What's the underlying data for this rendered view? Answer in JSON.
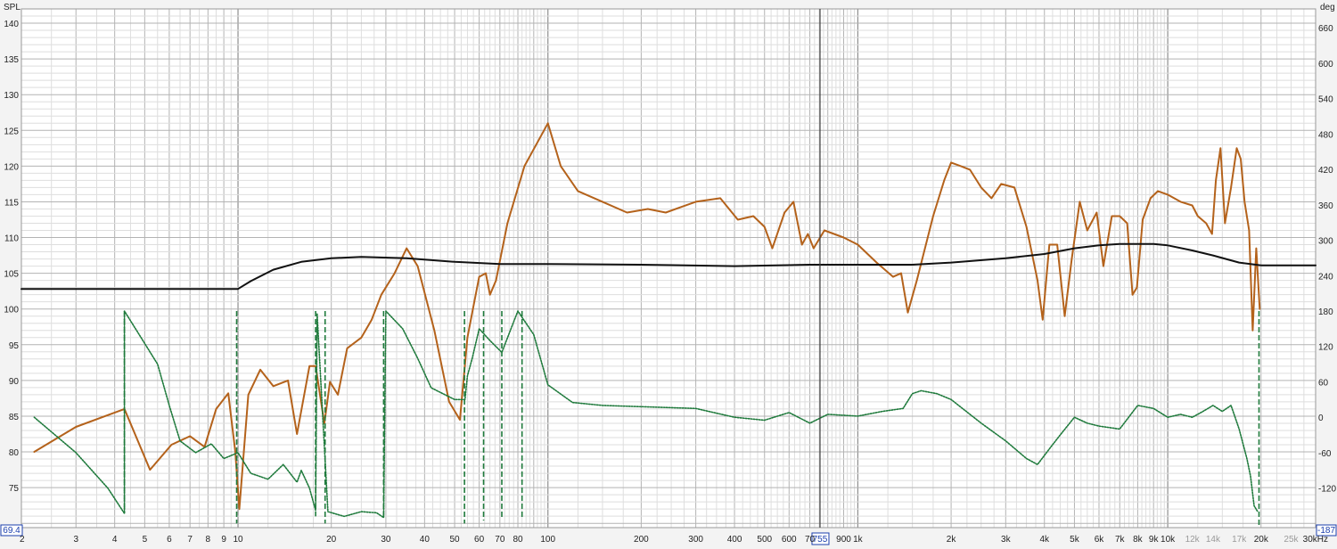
{
  "app": {
    "left_axis_title": "SPL",
    "right_axis_title": "deg"
  },
  "cursor": {
    "readout_freq": "755",
    "left_readout": "69.4",
    "right_readout": "-187"
  },
  "colors": {
    "spl_curve": "#b4621b",
    "phase_curve": "#1f7a3c",
    "black_curve": "#111111",
    "grid_major": "#b3b3b3",
    "grid_minor": "#dedede",
    "cursor_line": "#3a3a3a",
    "cursor_box": "#1b3fae"
  },
  "chart_data": {
    "type": "line",
    "x_scale": "log",
    "x_unit": "Hz",
    "xlim": [
      2,
      30000
    ],
    "ylim": [
      69.4,
      142
    ],
    "y_unit": "SPL",
    "y2lim": [
      -187,
      692
    ],
    "y2_unit": "deg",
    "grid": true,
    "x_ticks": [
      {
        "value": 2,
        "label": "2",
        "muted": false
      },
      {
        "value": 3,
        "label": "3",
        "muted": false
      },
      {
        "value": 4,
        "label": "4",
        "muted": false
      },
      {
        "value": 5,
        "label": "5",
        "muted": false
      },
      {
        "value": 6,
        "label": "6",
        "muted": false
      },
      {
        "value": 7,
        "label": "7",
        "muted": false
      },
      {
        "value": 8,
        "label": "8",
        "muted": false
      },
      {
        "value": 9,
        "label": "9",
        "muted": false
      },
      {
        "value": 10,
        "label": "10",
        "muted": false
      },
      {
        "value": 20,
        "label": "20",
        "muted": false
      },
      {
        "value": 30,
        "label": "30",
        "muted": false
      },
      {
        "value": 40,
        "label": "40",
        "muted": false
      },
      {
        "value": 50,
        "label": "50",
        "muted": false
      },
      {
        "value": 60,
        "label": "60",
        "muted": false
      },
      {
        "value": 70,
        "label": "70",
        "muted": false
      },
      {
        "value": 80,
        "label": "80",
        "muted": false
      },
      {
        "value": 100,
        "label": "100",
        "muted": false
      },
      {
        "value": 200,
        "label": "200",
        "muted": false
      },
      {
        "value": 300,
        "label": "300",
        "muted": false
      },
      {
        "value": 400,
        "label": "400",
        "muted": false
      },
      {
        "value": 500,
        "label": "500",
        "muted": false
      },
      {
        "value": 600,
        "label": "600",
        "muted": false
      },
      {
        "value": 700,
        "label": "70",
        "muted": false
      },
      {
        "value": 900,
        "label": "900",
        "muted": false
      },
      {
        "value": 1000,
        "label": "1k",
        "muted": false
      },
      {
        "value": 2000,
        "label": "2k",
        "muted": false
      },
      {
        "value": 3000,
        "label": "3k",
        "muted": false
      },
      {
        "value": 4000,
        "label": "4k",
        "muted": false
      },
      {
        "value": 5000,
        "label": "5k",
        "muted": false
      },
      {
        "value": 6000,
        "label": "6k",
        "muted": false
      },
      {
        "value": 7000,
        "label": "7k",
        "muted": false
      },
      {
        "value": 8000,
        "label": "8k",
        "muted": false
      },
      {
        "value": 9000,
        "label": "9k",
        "muted": false
      },
      {
        "value": 10000,
        "label": "10k",
        "muted": false
      },
      {
        "value": 12000,
        "label": "12k",
        "muted": true
      },
      {
        "value": 14000,
        "label": "14k",
        "muted": true
      },
      {
        "value": 17000,
        "label": "17k",
        "muted": true
      },
      {
        "value": 20000,
        "label": "20k",
        "muted": false
      },
      {
        "value": 25000,
        "label": "25k",
        "muted": true
      },
      {
        "value": 30000,
        "label": "30kHz",
        "muted": false
      }
    ],
    "y_ticks": [
      75,
      80,
      85,
      90,
      95,
      100,
      105,
      110,
      115,
      120,
      125,
      130,
      135,
      140
    ],
    "y2_ticks": [
      -120,
      -60,
      0,
      60,
      120,
      180,
      240,
      300,
      360,
      420,
      480,
      540,
      600,
      660
    ],
    "cursor_x": 755,
    "series": [
      {
        "key": "spl",
        "axis": "left",
        "style": "solid",
        "points": [
          [
            2.2,
            80
          ],
          [
            3,
            83.5
          ],
          [
            4.3,
            86
          ],
          [
            5.2,
            77.5
          ],
          [
            6.1,
            81
          ],
          [
            7,
            82.2
          ],
          [
            7.8,
            80.7
          ],
          [
            8.5,
            86
          ],
          [
            9.3,
            88.2
          ],
          [
            9.8,
            80
          ],
          [
            10.1,
            72
          ],
          [
            10.8,
            88
          ],
          [
            11.8,
            91.5
          ],
          [
            13,
            89.2
          ],
          [
            14.5,
            90
          ],
          [
            15.5,
            82.5
          ],
          [
            17,
            92
          ],
          [
            17.8,
            92
          ],
          [
            19,
            84
          ],
          [
            19.8,
            89.8
          ],
          [
            21,
            88
          ],
          [
            22.5,
            94.5
          ],
          [
            25,
            96
          ],
          [
            27,
            98.5
          ],
          [
            29,
            102
          ],
          [
            32,
            105
          ],
          [
            35,
            108.5
          ],
          [
            38,
            106
          ],
          [
            43,
            97
          ],
          [
            48,
            87
          ],
          [
            52,
            84.5
          ],
          [
            55,
            96
          ],
          [
            57,
            99.5
          ],
          [
            60,
            104.5
          ],
          [
            63,
            105
          ],
          [
            65,
            102
          ],
          [
            68,
            104
          ],
          [
            74,
            112
          ],
          [
            84,
            120
          ],
          [
            100,
            126
          ],
          [
            110,
            120
          ],
          [
            125,
            116.5
          ],
          [
            150,
            115
          ],
          [
            180,
            113.5
          ],
          [
            210,
            114
          ],
          [
            240,
            113.5
          ],
          [
            300,
            115
          ],
          [
            360,
            115.5
          ],
          [
            410,
            112.5
          ],
          [
            460,
            113
          ],
          [
            500,
            111.5
          ],
          [
            530,
            108.5
          ],
          [
            580,
            113.5
          ],
          [
            620,
            115
          ],
          [
            660,
            109
          ],
          [
            690,
            110.5
          ],
          [
            720,
            108.5
          ],
          [
            780,
            111
          ],
          [
            900,
            110
          ],
          [
            1000,
            109
          ],
          [
            1150,
            106.5
          ],
          [
            1300,
            104.5
          ],
          [
            1380,
            105
          ],
          [
            1450,
            99.5
          ],
          [
            1550,
            104
          ],
          [
            1750,
            113
          ],
          [
            1900,
            118
          ],
          [
            2000,
            120.5
          ],
          [
            2150,
            120
          ],
          [
            2300,
            119.5
          ],
          [
            2500,
            117
          ],
          [
            2700,
            115.5
          ],
          [
            2900,
            117.5
          ],
          [
            3200,
            117
          ],
          [
            3500,
            111.5
          ],
          [
            3800,
            104
          ],
          [
            3950,
            98.5
          ],
          [
            4150,
            109
          ],
          [
            4400,
            109
          ],
          [
            4650,
            99
          ],
          [
            4900,
            107
          ],
          [
            5200,
            115
          ],
          [
            5500,
            111
          ],
          [
            5900,
            113.5
          ],
          [
            6200,
            106
          ],
          [
            6600,
            113
          ],
          [
            7000,
            113
          ],
          [
            7400,
            112
          ],
          [
            7700,
            102
          ],
          [
            7950,
            103
          ],
          [
            8300,
            112.5
          ],
          [
            8800,
            115.5
          ],
          [
            9300,
            116.5
          ],
          [
            10000,
            116
          ],
          [
            11000,
            115
          ],
          [
            12000,
            114.5
          ],
          [
            12500,
            113
          ],
          [
            13300,
            112
          ],
          [
            13900,
            110.5
          ],
          [
            14300,
            118
          ],
          [
            14800,
            122.5
          ],
          [
            15300,
            112
          ],
          [
            16000,
            117
          ],
          [
            16700,
            122.5
          ],
          [
            17200,
            121
          ],
          [
            17700,
            115
          ],
          [
            18300,
            111
          ],
          [
            18800,
            97
          ],
          [
            19300,
            108.5
          ],
          [
            19800,
            100
          ]
        ]
      },
      {
        "key": "black",
        "axis": "left",
        "style": "solid",
        "points": [
          [
            2,
            102.8
          ],
          [
            10,
            102.8
          ],
          [
            11,
            103.9
          ],
          [
            13,
            105.5
          ],
          [
            16,
            106.6
          ],
          [
            20,
            107.1
          ],
          [
            25,
            107.3
          ],
          [
            35,
            107.1
          ],
          [
            50,
            106.6
          ],
          [
            70,
            106.3
          ],
          [
            100,
            106.3
          ],
          [
            200,
            106.2
          ],
          [
            400,
            106
          ],
          [
            700,
            106.2
          ],
          [
            1000,
            106.2
          ],
          [
            1500,
            106.2
          ],
          [
            2000,
            106.5
          ],
          [
            3000,
            107.1
          ],
          [
            4000,
            107.7
          ],
          [
            5000,
            108.5
          ],
          [
            6000,
            108.9
          ],
          [
            7000,
            109.1
          ],
          [
            9000,
            109.1
          ],
          [
            10000,
            108.9
          ],
          [
            12000,
            108.2
          ],
          [
            14000,
            107.5
          ],
          [
            17000,
            106.5
          ],
          [
            20000,
            106.1
          ],
          [
            30000,
            106.1
          ]
        ]
      },
      {
        "key": "phase",
        "axis": "right",
        "style": "dotted",
        "points": [
          [
            2.2,
            0
          ],
          [
            3,
            -60
          ],
          [
            3.8,
            -120
          ],
          [
            4.3,
            -163
          ],
          [
            4.3,
            180
          ],
          [
            4.8,
            140
          ],
          [
            5.5,
            90
          ],
          [
            6,
            20
          ],
          [
            6.5,
            -40
          ],
          [
            7.3,
            -60
          ],
          [
            8.2,
            -45
          ],
          [
            9,
            -70
          ],
          [
            10,
            -60
          ],
          [
            11,
            -95
          ],
          [
            12.5,
            -105
          ],
          [
            14,
            -80
          ],
          [
            15.5,
            -110
          ],
          [
            16,
            -90
          ],
          [
            17,
            -120
          ],
          [
            17.8,
            -158
          ],
          [
            18,
            175
          ],
          [
            19.5,
            -160
          ],
          [
            22,
            -168
          ],
          [
            25,
            -160
          ],
          [
            28,
            -162
          ],
          [
            29.5,
            -170
          ],
          [
            30,
            180
          ],
          [
            34,
            150
          ],
          [
            38,
            100
          ],
          [
            42,
            50
          ],
          [
            50,
            30
          ],
          [
            54,
            30
          ],
          [
            55,
            70
          ],
          [
            57,
            100
          ],
          [
            60,
            150
          ],
          [
            65,
            130
          ],
          [
            71,
            110
          ],
          [
            80,
            180
          ],
          [
            90,
            140
          ],
          [
            100,
            55
          ],
          [
            120,
            25
          ],
          [
            150,
            20
          ],
          [
            200,
            18
          ],
          [
            300,
            15
          ],
          [
            400,
            0
          ],
          [
            500,
            -5
          ],
          [
            600,
            8
          ],
          [
            700,
            -10
          ],
          [
            800,
            5
          ],
          [
            1000,
            2
          ],
          [
            1200,
            10
          ],
          [
            1400,
            15
          ],
          [
            1500,
            40
          ],
          [
            1600,
            45
          ],
          [
            1800,
            40
          ],
          [
            2000,
            30
          ],
          [
            2500,
            -10
          ],
          [
            3000,
            -40
          ],
          [
            3500,
            -70
          ],
          [
            3800,
            -80
          ],
          [
            4200,
            -50
          ],
          [
            4500,
            -30
          ],
          [
            5000,
            0
          ],
          [
            5500,
            -10
          ],
          [
            6000,
            -15
          ],
          [
            7000,
            -20
          ],
          [
            8000,
            20
          ],
          [
            9000,
            15
          ],
          [
            10000,
            0
          ],
          [
            11000,
            5
          ],
          [
            12000,
            0
          ],
          [
            13000,
            10
          ],
          [
            14000,
            20
          ],
          [
            15000,
            10
          ],
          [
            16000,
            20
          ],
          [
            17000,
            -20
          ],
          [
            18000,
            -70
          ],
          [
            18500,
            -100
          ],
          [
            19000,
            -150
          ],
          [
            19500,
            -160
          ]
        ]
      }
    ],
    "phase_wrap_x": [
      4.3,
      9.9,
      17.8,
      19.1,
      29.5,
      53.8,
      62,
      71,
      82.5,
      19700
    ],
    "phase_wrap_tops": [
      180,
      180,
      180,
      180,
      180,
      180,
      180,
      180,
      180,
      180
    ],
    "phase_wrap_bottoms": [
      -163,
      -180,
      -168,
      -180,
      -168,
      -180,
      -175,
      -172,
      -172,
      -187
    ]
  }
}
